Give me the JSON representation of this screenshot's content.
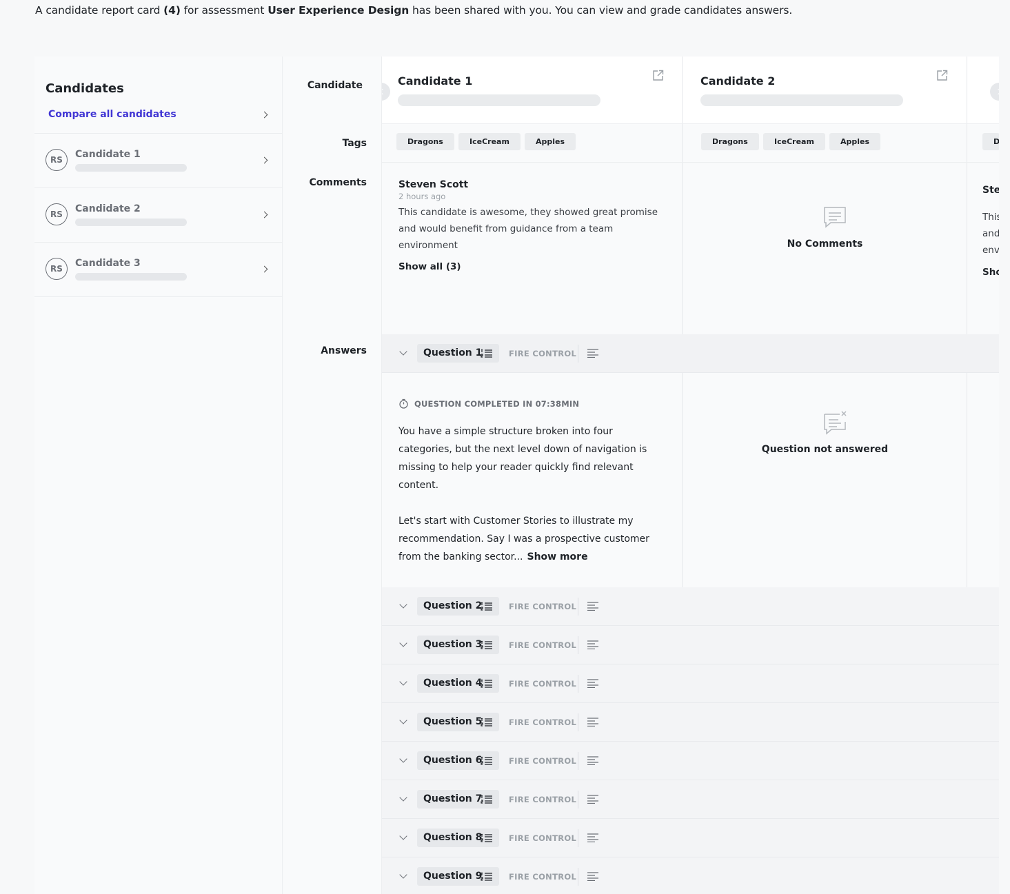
{
  "intro": {
    "part1": "A candidate report card ",
    "count": "(4)",
    "part2": " for assessment ",
    "assessment": "User Experience Design",
    "part3": " has been shared with you. You can view and grade candidates answers."
  },
  "sidebar": {
    "title": "Candidates",
    "compare_label": "Compare all candidates",
    "items": [
      {
        "initials": "RS",
        "name": "Candidate 1"
      },
      {
        "initials": "RS",
        "name": "Candidate 2"
      },
      {
        "initials": "RS",
        "name": "Candidate 3"
      }
    ]
  },
  "labels": {
    "candidate": "Candidate",
    "tags": "Tags",
    "comments": "Comments",
    "answers": "Answers"
  },
  "columns": [
    {
      "name": "Candidate 1",
      "tags": [
        "Dragons",
        "IceCream",
        "Apples"
      ],
      "comment": {
        "author": "Steven Scott",
        "time": "2 hours ago",
        "text": "This candidate is awesome, they showed great promise and would benefit from guidance from a team environment",
        "show_all": "Show all (3)"
      },
      "answer": {
        "completed": "QUESTION COMPLETED IN 07:38MIN",
        "p1": "You have a simple structure broken into four categories, but the next level down of navigation is missing to help your reader quickly find relevant content.",
        "p2": "Let's start with Customer Stories to illustrate my recommendation. Say I was a prospective customer from the banking sector...",
        "show_more": "Show more"
      }
    },
    {
      "name": "Candidate 2",
      "tags": [
        "Dragons",
        "IceCream",
        "Apples"
      ],
      "no_comments": "No Comments",
      "not_answered": "Question not answered"
    },
    {
      "tag_peek": "D",
      "author_peek": "Ste",
      "text_peek": [
        "This",
        "and",
        "env"
      ],
      "show_peek": "Sho"
    }
  ],
  "questions": [
    {
      "label": "Question 1",
      "category": "FIRE CONTROL"
    },
    {
      "label": "Question 2",
      "category": "FIRE CONTROL"
    },
    {
      "label": "Question 3",
      "category": "FIRE CONTROL"
    },
    {
      "label": "Question 4",
      "category": "FIRE CONTROL"
    },
    {
      "label": "Question 5",
      "category": "FIRE CONTROL"
    },
    {
      "label": "Question 6",
      "category": "FIRE CONTROL"
    },
    {
      "label": "Question 7",
      "category": "FIRE CONTROL"
    },
    {
      "label": "Question 8",
      "category": "FIRE CONTROL"
    },
    {
      "label": "Question 9",
      "category": "FIRE CONTROL"
    }
  ],
  "colors": {
    "accent": "#4136d4",
    "text": "#1f2328",
    "muted": "#9aa0a6"
  }
}
